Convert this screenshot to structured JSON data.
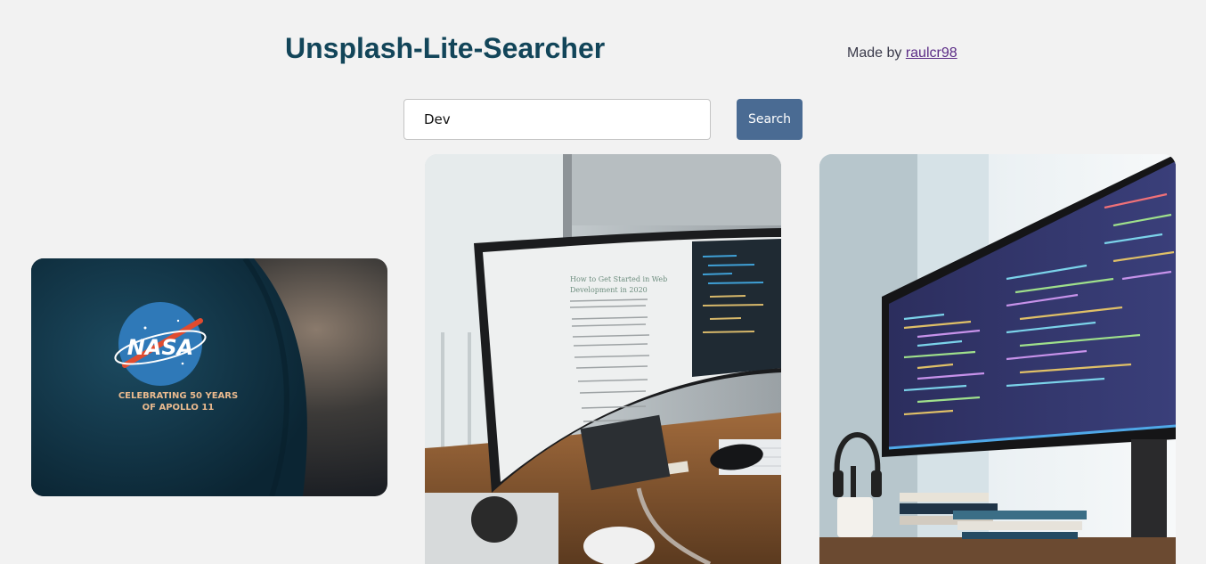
{
  "header": {
    "title": "Unsplash-Lite-Searcher",
    "credit_prefix": "Made by",
    "credit_link": "raulcr98"
  },
  "search": {
    "value": "Dev",
    "button_label": "Search"
  },
  "results": [
    {
      "name": "nasa-sweater-photo",
      "patch_title": "NASA",
      "patch_caption_1": "CELEBRATING 50 YEARS",
      "patch_caption_2": "OF APOLLO 11"
    },
    {
      "name": "monitor-blog-photo",
      "screen_heading_1": "How to Get Started in Web",
      "screen_heading_2": "Development in 2020"
    },
    {
      "name": "code-monitor-photo"
    }
  ]
}
